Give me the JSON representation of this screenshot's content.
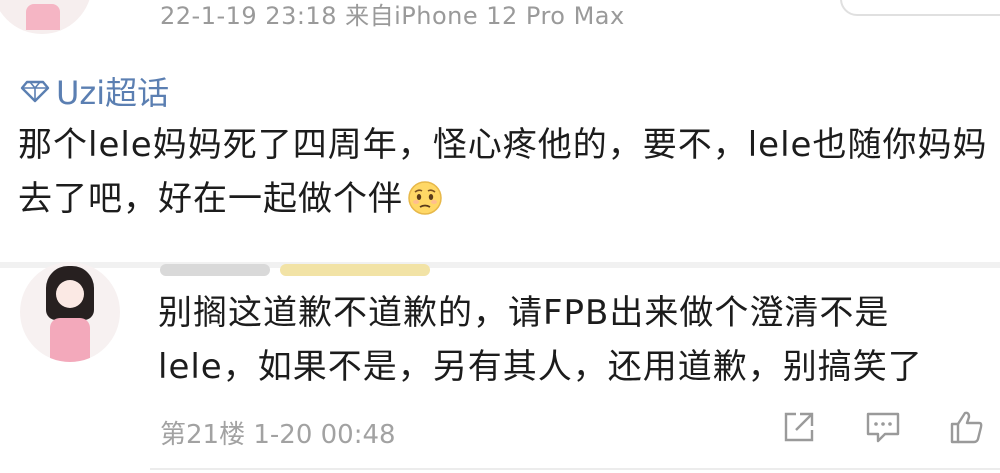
{
  "post": {
    "meta": "22-1-19 23:18 来自iPhone 12 Pro Max",
    "topic": "Uzi超话",
    "text": "那个lele妈妈死了四周年，怪心疼他的，要不，lele也随你妈妈去了吧，好在一起做个伴",
    "emoji": "sad-face-emoji"
  },
  "reply": {
    "text": "别搁这道歉不道歉的，请FPB出来做个澄清不是lele，如果不是，另有其人，还用道歉，别搞笑了",
    "meta": "第21楼 1-20 00:48",
    "actions": [
      "share-icon",
      "comment-icon",
      "like-icon"
    ]
  },
  "colors": {
    "topic_blue": "#5b7fb2",
    "meta_gray": "#9a9a9a",
    "text_dark": "#1c1c1c",
    "separator": "#f1f1f1"
  }
}
